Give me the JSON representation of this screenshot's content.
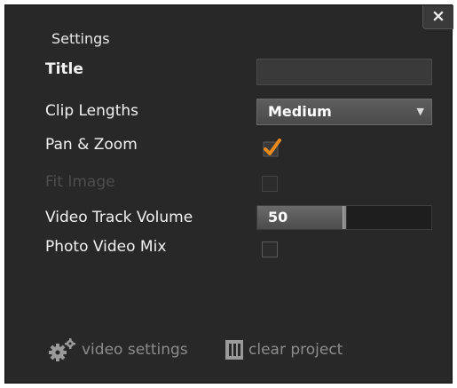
{
  "dialog": {
    "close_label": "×",
    "heading": "Settings"
  },
  "fields": {
    "title": {
      "label": "Title",
      "value": ""
    },
    "clip_lengths": {
      "label": "Clip Lengths",
      "selected": "Medium"
    },
    "pan_zoom": {
      "label": "Pan & Zoom",
      "checked": true
    },
    "fit_image": {
      "label": "Fit Image",
      "checked": false,
      "disabled": true
    },
    "video_track_volume": {
      "label": "Video Track Volume",
      "value": "50",
      "level_percent": 50
    },
    "photo_video_mix": {
      "label": "Photo Video Mix",
      "checked": false
    }
  },
  "actions": {
    "video_settings": {
      "label": "video settings",
      "icon": "gears-icon"
    },
    "clear_project": {
      "label": "clear project",
      "icon": "film-strip-icon"
    }
  },
  "colors": {
    "panel_bg": "#282828",
    "checkmark": "#e88a1a",
    "text": "#f2f2f2",
    "muted": "#8c8c8c"
  }
}
